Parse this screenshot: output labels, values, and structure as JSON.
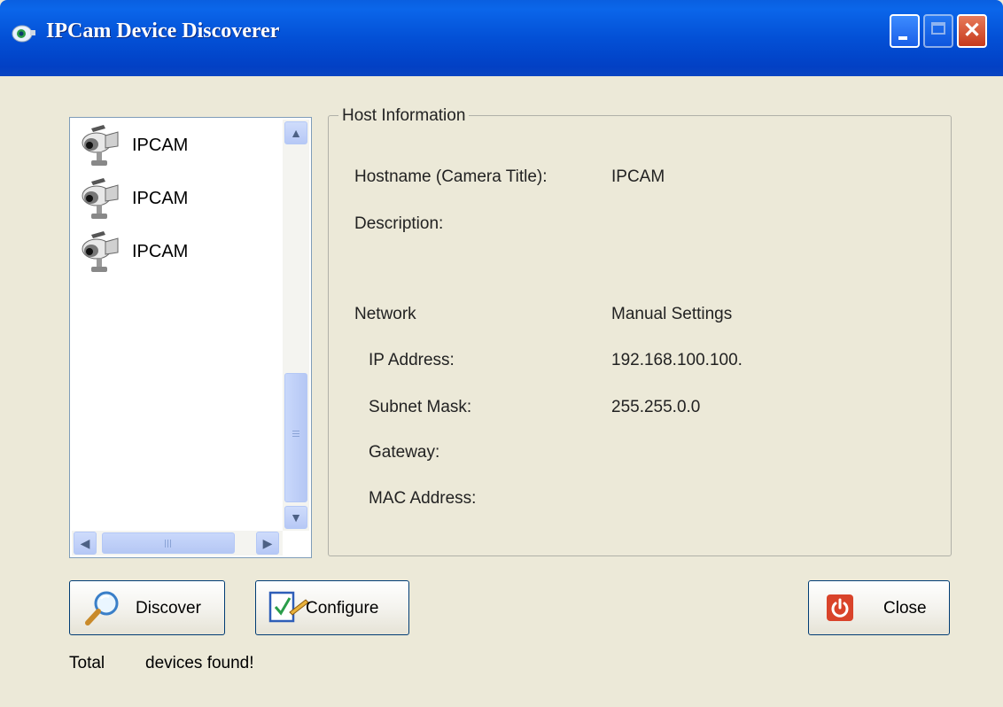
{
  "window": {
    "title": "IPCam Device Discoverer"
  },
  "device_list": {
    "items": [
      {
        "label": "IPCAM",
        "icon": "camera-icon"
      },
      {
        "label": "IPCAM",
        "icon": "camera-icon"
      },
      {
        "label": "IPCAM",
        "icon": "camera-icon"
      }
    ]
  },
  "host_info": {
    "legend": "Host Information",
    "hostname_label": "Hostname (Camera Title):",
    "hostname_value": "IPCAM",
    "description_label": "Description:",
    "network_label": "Network",
    "network_value": "Manual Settings",
    "ip_label": "IP Address:",
    "ip_value": "192.168.100.100.",
    "subnet_label": "Subnet Mask:",
    "subnet_value": "255.255.0.0",
    "gateway_label": "Gateway:",
    "mac_label": "MAC Address:"
  },
  "buttons": {
    "discover": "Discover",
    "configure": "Configure",
    "close": "Close"
  },
  "status": {
    "prefix": "Total",
    "suffix": "devices found!"
  },
  "colors": {
    "title_bar": "#0350d6",
    "window_bg": "#ece9d8",
    "close_red": "#d9432a"
  }
}
